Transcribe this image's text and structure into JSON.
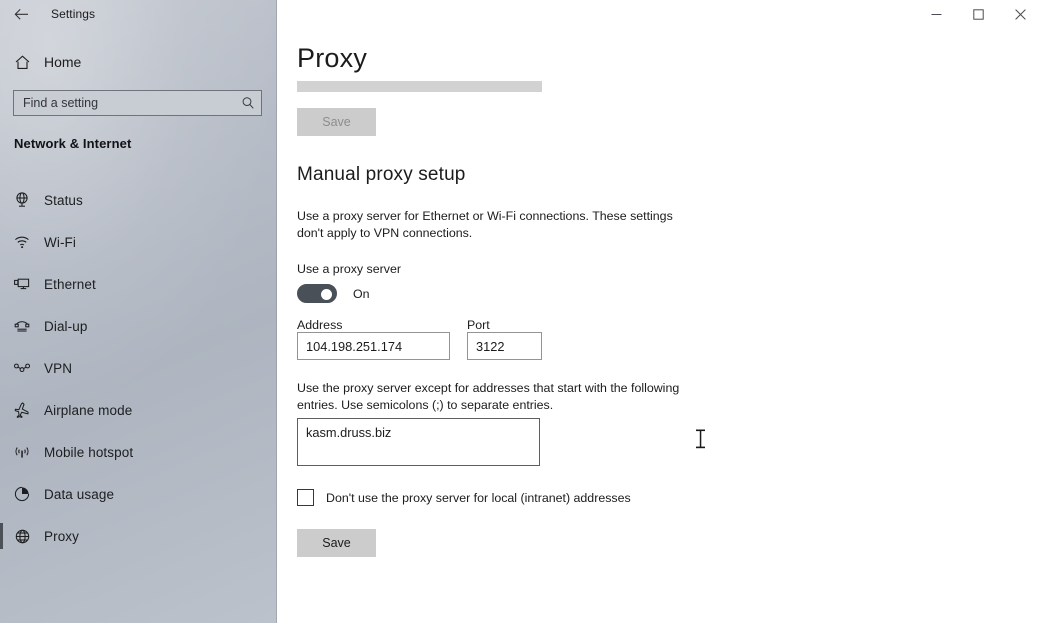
{
  "window": {
    "title": "Settings",
    "back_icon": "back-arrow-icon",
    "minimize_label": "Minimize",
    "maximize_label": "Maximize",
    "close_label": "Close"
  },
  "sidebar": {
    "home_label": "Home",
    "home_icon": "home-icon",
    "search": {
      "placeholder": "Find a setting",
      "value": "",
      "icon": "search-icon"
    },
    "section_header": "Network & Internet",
    "items": [
      {
        "label": "Status",
        "icon": "status-globe-icon",
        "selected": false
      },
      {
        "label": "Wi-Fi",
        "icon": "wifi-icon",
        "selected": false
      },
      {
        "label": "Ethernet",
        "icon": "ethernet-icon",
        "selected": false
      },
      {
        "label": "Dial-up",
        "icon": "dialup-phone-icon",
        "selected": false
      },
      {
        "label": "VPN",
        "icon": "vpn-icon",
        "selected": false
      },
      {
        "label": "Airplane mode",
        "icon": "airplane-icon",
        "selected": false
      },
      {
        "label": "Mobile hotspot",
        "icon": "hotspot-icon",
        "selected": false
      },
      {
        "label": "Data usage",
        "icon": "pie-chart-icon",
        "selected": false
      },
      {
        "label": "Proxy",
        "icon": "globe-icon",
        "selected": true
      }
    ]
  },
  "main": {
    "page_title": "Proxy",
    "save_top_label": "Save",
    "save_top_disabled": true,
    "manual_setup_heading": "Manual proxy setup",
    "manual_setup_description": "Use a proxy server for Ethernet or Wi-Fi connections. These settings don't apply to VPN connections.",
    "use_proxy_label": "Use a proxy server",
    "use_proxy_state": "On",
    "use_proxy_on": true,
    "address_label": "Address",
    "address_value": "104.198.251.174",
    "port_label": "Port",
    "port_value": "3122",
    "exceptions_description": "Use the proxy server except for addresses that start with the following entries. Use semicolons (;) to separate entries.",
    "exceptions_value": "kasm.druss.biz",
    "bypass_local_label": "Don't use the proxy server for local (intranet) addresses",
    "bypass_local_checked": false,
    "save_bottom_label": "Save"
  },
  "colors": {
    "sidebar_base": "#b7bdc7",
    "accent_selection": "#4c5158",
    "toggle_on": "#4a5058",
    "button_face": "#cccccc",
    "ghost_bar": "#d2d2d2"
  }
}
